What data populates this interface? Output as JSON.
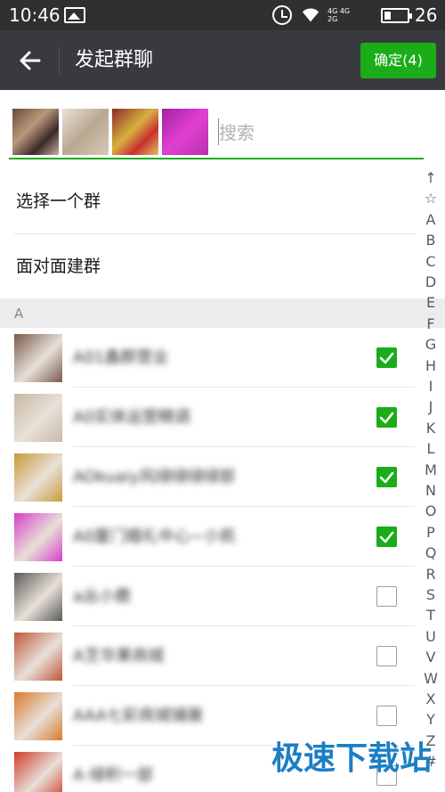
{
  "status_bar": {
    "time": "10:46",
    "battery": "26",
    "net_top": "4G 4G",
    "net_bottom": "2G"
  },
  "header": {
    "title": "发起群聊",
    "confirm_label": "确定(4)"
  },
  "search": {
    "placeholder": "搜索"
  },
  "menu": {
    "choose_group": "选择一个群",
    "face_to_face": "面对面建群"
  },
  "section": {
    "label": "A"
  },
  "contacts": [
    {
      "name": "A01鑫群营业",
      "checked": true,
      "color": "#7a5a4a"
    },
    {
      "name": "A0实体运营精调",
      "checked": true,
      "color": "#c9b8a6"
    },
    {
      "name": "AOkuaiy风绿绿绿绿部",
      "checked": true,
      "color": "#c99a3a"
    },
    {
      "name": "A0厦门婚礼中心~小凯",
      "checked": true,
      "color": "#d63fc8"
    },
    {
      "name": "a丛小鹿",
      "checked": false,
      "color": "#5a5a5a"
    },
    {
      "name": "A芝华果商城",
      "checked": false,
      "color": "#c0563b"
    },
    {
      "name": "AAA七彩商城铺展",
      "checked": false,
      "color": "#d97a2a"
    },
    {
      "name": "A·禄积一部",
      "checked": false,
      "color": "#d23a2a"
    }
  ],
  "index_letters": [
    "↑",
    "☆",
    "A",
    "B",
    "C",
    "D",
    "E",
    "F",
    "G",
    "H",
    "I",
    "J",
    "K",
    "L",
    "M",
    "N",
    "O",
    "P",
    "Q",
    "R",
    "S",
    "T",
    "U",
    "V",
    "W",
    "X",
    "Y",
    "Z",
    "#"
  ],
  "watermark": {
    "text": "极速下载站"
  },
  "colors": {
    "accent": "#1aad19",
    "header_bg": "#393a3f",
    "status_bg": "#303030"
  }
}
